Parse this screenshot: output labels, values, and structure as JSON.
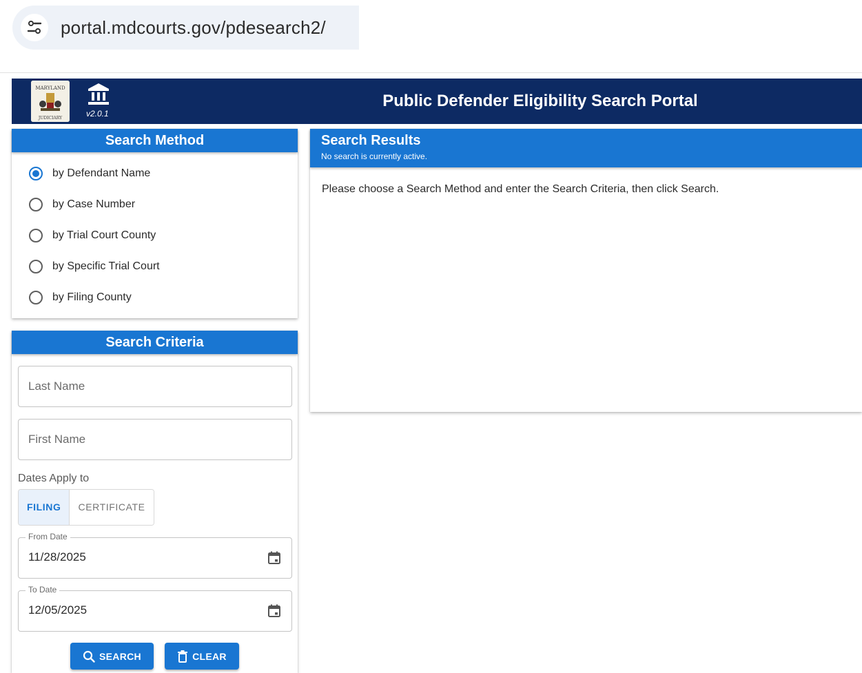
{
  "browser": {
    "url": "portal.mdcourts.gov/pdesearch2/",
    "tune_icon": "tune-icon"
  },
  "header": {
    "seal_top_text": "MARYLAND",
    "seal_bottom_text": "JUDICIARY",
    "version": "v2.0.1",
    "title": "Public Defender Eligibility Search Portal",
    "color": "#0d2a63"
  },
  "search_method": {
    "title": "Search Method",
    "options": [
      {
        "label": "by Defendant Name",
        "selected": true
      },
      {
        "label": "by Case Number",
        "selected": false
      },
      {
        "label": "by Trial Court County",
        "selected": false
      },
      {
        "label": "by Specific Trial Court",
        "selected": false
      },
      {
        "label": "by Filing County",
        "selected": false
      }
    ]
  },
  "search_criteria": {
    "title": "Search Criteria",
    "last_name_placeholder": "Last Name",
    "first_name_placeholder": "First Name",
    "dates_apply_label": "Dates Apply to",
    "toggle_filing": "FILING",
    "toggle_certificate": "CERTIFICATE",
    "from_date_label": "From Date",
    "from_date_value": "11/28/2025",
    "to_date_label": "To Date",
    "to_date_value": "12/05/2025",
    "search_button": "SEARCH",
    "clear_button": "CLEAR"
  },
  "results": {
    "title": "Search Results",
    "subtitle": "No search is currently active.",
    "message": "Please choose a Search Method and enter the Search Criteria, then click Search."
  },
  "colors": {
    "accent": "#1976d2",
    "header": "#0d2a63"
  }
}
